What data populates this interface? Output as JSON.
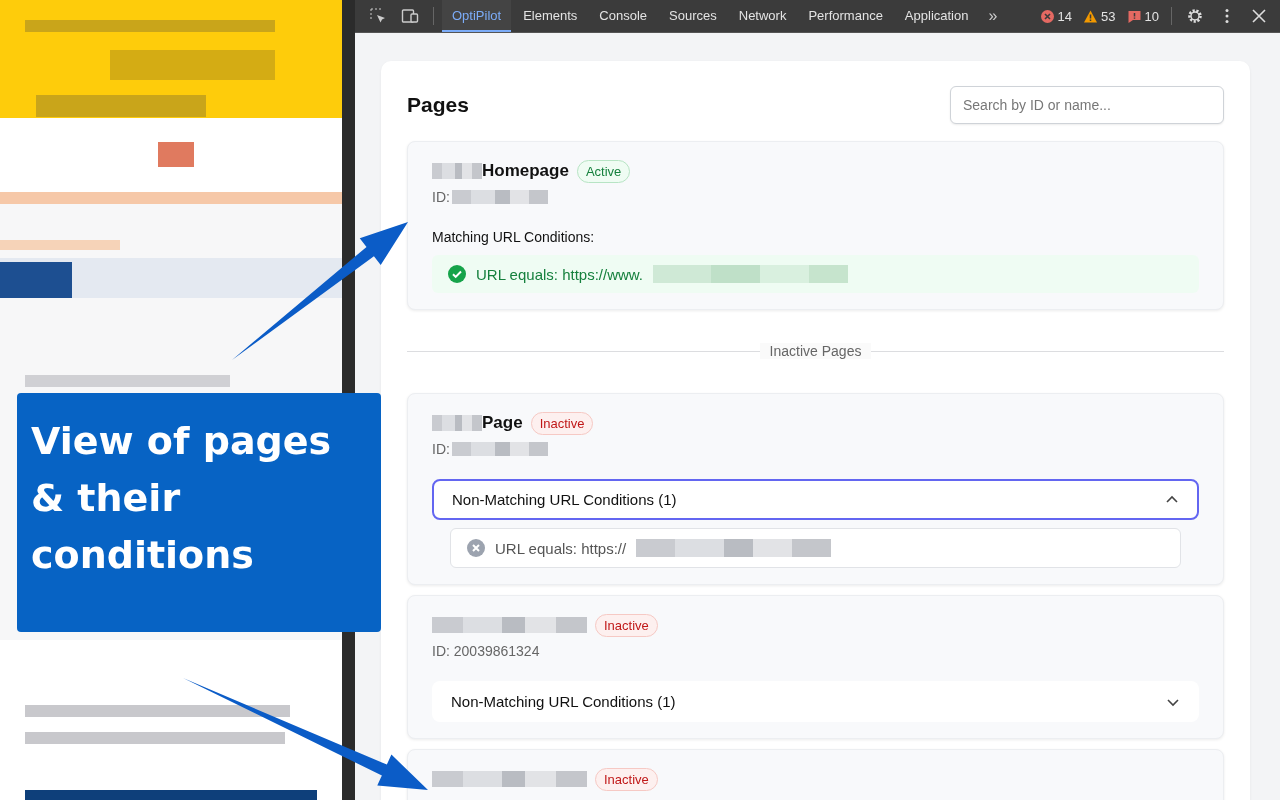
{
  "devtools": {
    "tabs": [
      {
        "label": "OptiPilot",
        "selected": true
      },
      {
        "label": "Elements",
        "selected": false
      },
      {
        "label": "Console",
        "selected": false
      },
      {
        "label": "Sources",
        "selected": false
      },
      {
        "label": "Network",
        "selected": false
      },
      {
        "label": "Performance",
        "selected": false
      },
      {
        "label": "Application",
        "selected": false
      }
    ],
    "more": "»",
    "counters": [
      {
        "kind": "error",
        "count": "14"
      },
      {
        "kind": "warning",
        "count": "53"
      },
      {
        "kind": "issue",
        "count": "10"
      }
    ]
  },
  "panel": {
    "title": "Pages",
    "search": {
      "placeholder": "Search by ID or name..."
    },
    "active_pages": [
      {
        "name": "Homepage",
        "status": {
          "label": "Active",
          "kind": "active"
        },
        "id_label": "ID:",
        "conditions_title": "Matching URL Conditions:",
        "conditions": [
          {
            "text": "URL equals: https://www.",
            "met": true
          }
        ]
      }
    ],
    "divider": "Inactive Pages",
    "inactive_pages": [
      {
        "name": "Page",
        "status": {
          "label": "Inactive",
          "kind": "inactive"
        },
        "id_label": "ID:",
        "accordion": {
          "label": "Non-Matching URL Conditions (1)",
          "expanded": true
        },
        "conditions": [
          {
            "text": "URL equals: https://",
            "met": false
          }
        ]
      },
      {
        "status": {
          "label": "Inactive",
          "kind": "inactive"
        },
        "id_label": "ID: 20039861324",
        "accordion": {
          "label": "Non-Matching URL Conditions (1)",
          "expanded": false
        }
      },
      {
        "status": {
          "label": "Inactive",
          "kind": "inactive"
        }
      }
    ]
  },
  "callout": {
    "text": "View of pages\n& their\nconditions"
  }
}
